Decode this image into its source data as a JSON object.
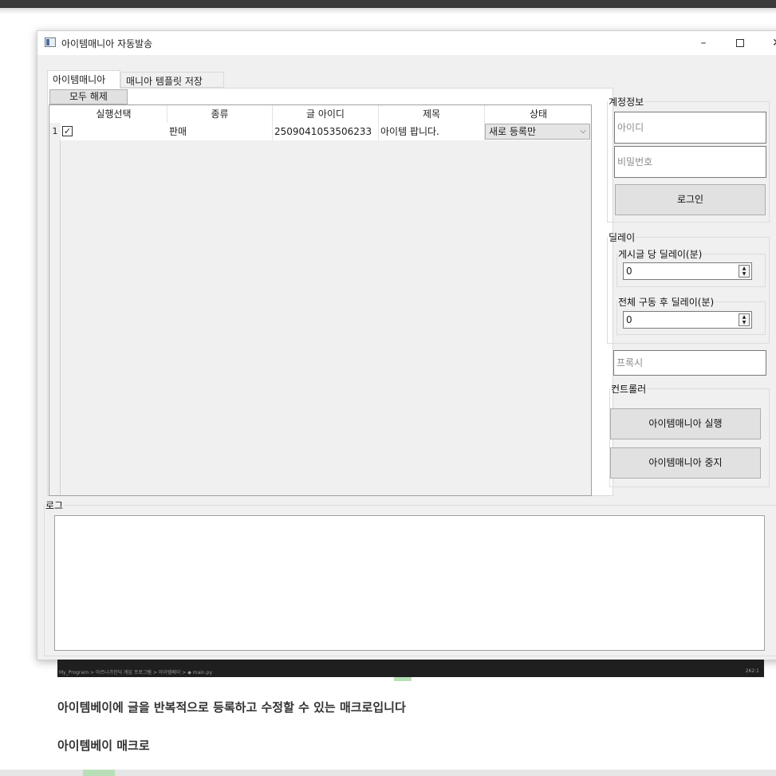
{
  "window": {
    "title": "아이템매니아 자동발송",
    "controls": {
      "minimize": "–",
      "close": "✕"
    }
  },
  "tabs": [
    {
      "label": "아이템매니아",
      "active": true
    },
    {
      "label": "매니아 템플릿 저장",
      "active": false
    }
  ],
  "unselect_all_label": "모두 해제",
  "table": {
    "headers": [
      "실행선택",
      "종류",
      "글 아이디",
      "제목",
      "상태"
    ],
    "rows": [
      {
        "index": "1",
        "checked": true,
        "check_glyph": "✓",
        "type": "판매",
        "post_id": "2509041053506233",
        "title": "아이템 팝니다.",
        "status": "새로 등록만"
      }
    ],
    "combo_arrow": "⌵"
  },
  "account": {
    "legend": "계정정보",
    "id_placeholder": "아이디",
    "pw_placeholder": "비밀번호",
    "login_label": "로그인"
  },
  "delay": {
    "legend": "딜레이",
    "per_post_legend": "게시글 당 딜레이(분)",
    "per_post_value": "0",
    "after_run_legend": "전체 구동 후 딜레이(분)",
    "after_run_value": "0",
    "spin_up": "▲",
    "spin_down": "▼"
  },
  "proxy_placeholder": "프록시",
  "controller": {
    "legend": "컨트롤러",
    "run_label": "아이템매니아 실행",
    "stop_label": "아이템매니아 중지"
  },
  "log_legend": "로그",
  "editor_status": {
    "breadcrumb": "My_Program  >  아르나가한딕 게임 프로그램  >  아이템베이  >  ◆ main.py",
    "position": "262:1"
  },
  "captions": {
    "line1": "아이템베이에 글을 반복적으로 등록하고 수정할 수 있는 매크로입니다",
    "line2": "아이템베이 매크로"
  },
  "colors": {
    "window_bg": "#f0f0f0",
    "button_bg": "#e1e1e1",
    "status_bar": "#1f1f1f",
    "green_mark": "#b8e0b8"
  }
}
